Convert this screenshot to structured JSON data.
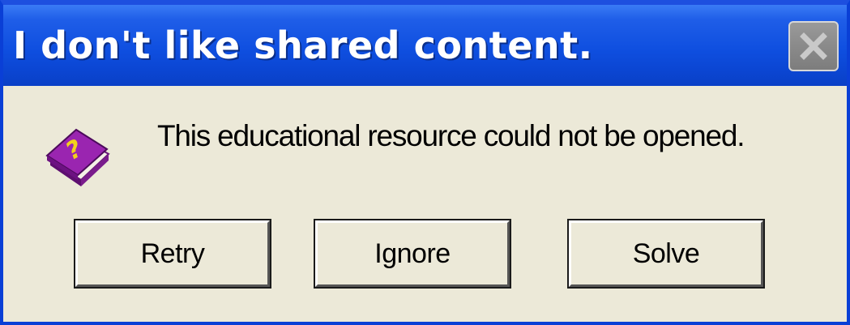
{
  "dialog": {
    "title": "I don't like shared content.",
    "message": "This educational resource could not be opened.",
    "icon": "help-book-icon",
    "close_icon": "close-icon"
  },
  "buttons": {
    "retry_label": "Retry",
    "ignore_label": "Ignore",
    "solve_label": "Solve"
  },
  "colors": {
    "titlebar": "#0f4fe0",
    "dialog_background": "#ece9d8",
    "close_button": "#8a8a8a",
    "book_purple": "#8a1f9e",
    "book_question_mark": "#f2d21b"
  }
}
